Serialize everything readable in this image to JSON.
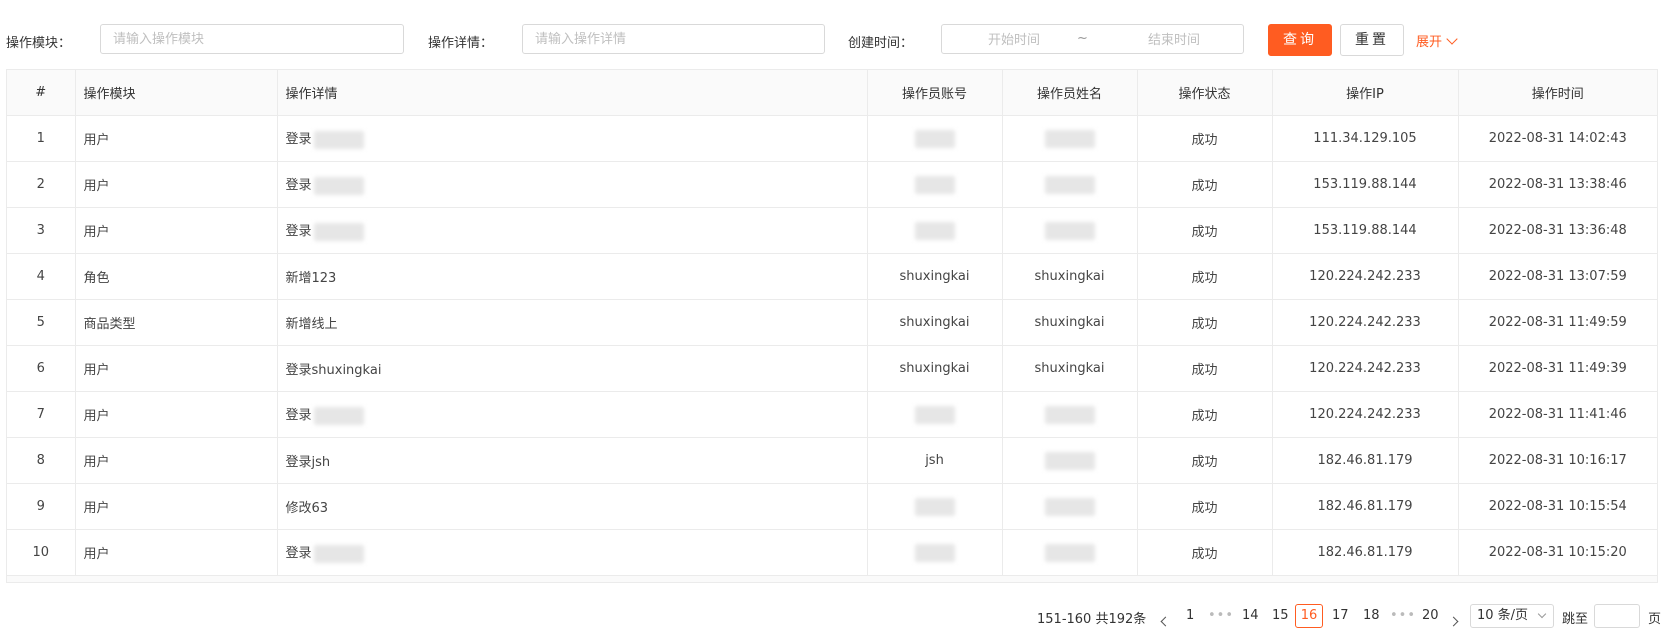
{
  "filters": {
    "module_label": "操作模块：",
    "module_placeholder": "请输入操作模块",
    "detail_label": "操作详情：",
    "detail_placeholder": "请输入操作详情",
    "time_label": "创建时间：",
    "start_placeholder": "开始时间",
    "range_separator": "~",
    "end_placeholder": "结束时间",
    "search_button": "查询",
    "reset_button": "重置",
    "expand_label": "展开"
  },
  "table": {
    "columns": [
      "#",
      "操作模块",
      "操作详情",
      "操作员账号",
      "操作员姓名",
      "操作状态",
      "操作IP",
      "操作时间"
    ],
    "rows": [
      {
        "index": "1",
        "module": "用户",
        "detail": "登录",
        "account": "",
        "name": "",
        "status": "成功",
        "ip": "111.34.129.105",
        "time": "2022-08-31 14:02:43"
      },
      {
        "index": "2",
        "module": "用户",
        "detail": "登录",
        "account": "",
        "name": "",
        "status": "成功",
        "ip": "153.119.88.144",
        "time": "2022-08-31 13:38:46"
      },
      {
        "index": "3",
        "module": "用户",
        "detail": "登录",
        "account": "",
        "name": "",
        "status": "成功",
        "ip": "153.119.88.144",
        "time": "2022-08-31 13:36:48"
      },
      {
        "index": "4",
        "module": "角色",
        "detail": "新增123",
        "account": "shuxingkai",
        "name": "shuxingkai",
        "status": "成功",
        "ip": "120.224.242.233",
        "time": "2022-08-31 13:07:59"
      },
      {
        "index": "5",
        "module": "商品类型",
        "detail": "新增线上",
        "account": "shuxingkai",
        "name": "shuxingkai",
        "status": "成功",
        "ip": "120.224.242.233",
        "time": "2022-08-31 11:49:59"
      },
      {
        "index": "6",
        "module": "用户",
        "detail": "登录shuxingkai",
        "account": "shuxingkai",
        "name": "shuxingkai",
        "status": "成功",
        "ip": "120.224.242.233",
        "time": "2022-08-31 11:49:39"
      },
      {
        "index": "7",
        "module": "用户",
        "detail": "登录",
        "account": "",
        "name": "",
        "status": "成功",
        "ip": "120.224.242.233",
        "time": "2022-08-31 11:41:46"
      },
      {
        "index": "8",
        "module": "用户",
        "detail": "登录jsh",
        "account": "jsh",
        "name": "",
        "status": "成功",
        "ip": "182.46.81.179",
        "time": "2022-08-31 10:16:17"
      },
      {
        "index": "9",
        "module": "用户",
        "detail": "修改63",
        "account": "",
        "name": "",
        "status": "成功",
        "ip": "182.46.81.179",
        "time": "2022-08-31 10:15:54"
      },
      {
        "index": "10",
        "module": "用户",
        "detail": "登录",
        "account": "",
        "name": "",
        "status": "成功",
        "ip": "182.46.81.179",
        "time": "2022-08-31 10:15:20"
      }
    ]
  },
  "pagination": {
    "total_text": "151-160 共192条",
    "pages": [
      "1",
      "14",
      "15",
      "16",
      "17",
      "18",
      "20"
    ],
    "current_page": "16",
    "ellipsis": "•••",
    "page_size": "10 条/页",
    "jump_label": "跳至",
    "page_suffix": "页"
  },
  "colors": {
    "accent": "#ff5c21",
    "border": "#ebebeb"
  }
}
